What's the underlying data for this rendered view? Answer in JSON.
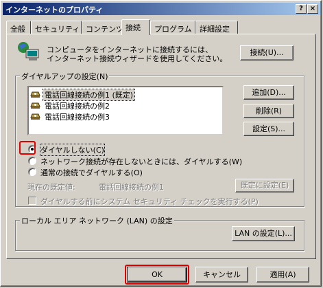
{
  "window": {
    "title": "インターネットのプロパティ",
    "help_glyph": "?",
    "close_glyph": "×"
  },
  "tabs": [
    {
      "label": "全般"
    },
    {
      "label": "セキュリティ"
    },
    {
      "label": "コンテンツ"
    },
    {
      "label": "接続"
    },
    {
      "label": "プログラム"
    },
    {
      "label": "詳細設定"
    }
  ],
  "connect": {
    "text_line1": "コンピュータをインターネットに接続するには、",
    "text_line2": "インターネット接続ウィザードを使用してください。",
    "connect_button": "接続(U)..."
  },
  "dialup": {
    "group_label": "ダイヤルアップの設定(N)",
    "entries": [
      {
        "label": "電話回線接続の例1 (既定)"
      },
      {
        "label": "電話回線接続の例2"
      },
      {
        "label": "電話回線接続の例3"
      }
    ],
    "add_button": "追加(D)...",
    "delete_button": "削除(R)",
    "settings_button": "設定(S)...",
    "options": [
      {
        "label": "ダイヤルしない(C)",
        "selected": true
      },
      {
        "label": "ネットワーク接続が存在しないときには、ダイヤルする(W)",
        "selected": false
      },
      {
        "label": "通常の接続でダイヤルする(O)",
        "selected": false
      }
    ],
    "current_default_label": "現在の既定値:",
    "current_default_value": "電話回線接続の例1",
    "set_default_button": "既定に設定(E)",
    "security_check_label": "ダイヤルする前にシステム セキュリティ チェックを実行する(P)"
  },
  "lan": {
    "group_label": "ローカル エリア ネットワーク (LAN) の設定",
    "button": "LAN の設定(L)..."
  },
  "footer": {
    "ok": "OK",
    "cancel": "キャンセル",
    "apply": "適用(A)"
  },
  "colors": {
    "titlebar_start": "#0a246a",
    "titlebar_end": "#a6caf0",
    "highlight_box": "#e00000"
  }
}
